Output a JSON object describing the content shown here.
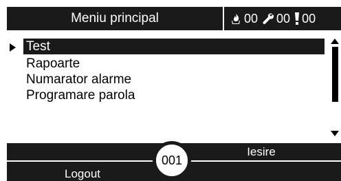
{
  "header": {
    "title": "Meniu principal",
    "counters": [
      {
        "icon": "flame-icon",
        "value": "00"
      },
      {
        "icon": "wrench-icon",
        "value": "00"
      },
      {
        "icon": "exclamation-icon",
        "value": "00"
      }
    ]
  },
  "menu": {
    "selected_index": 0,
    "items": [
      {
        "label": "Test"
      },
      {
        "label": "Rapoarte"
      },
      {
        "label": "Numarator alarme"
      },
      {
        "label": "Programare parola"
      }
    ]
  },
  "bottom_bar": {
    "right_softkey": "Iesire",
    "left_softkey": "Logout",
    "code": "001"
  },
  "colors": {
    "bar": "#1a1a1a",
    "background": "#ffffff"
  }
}
